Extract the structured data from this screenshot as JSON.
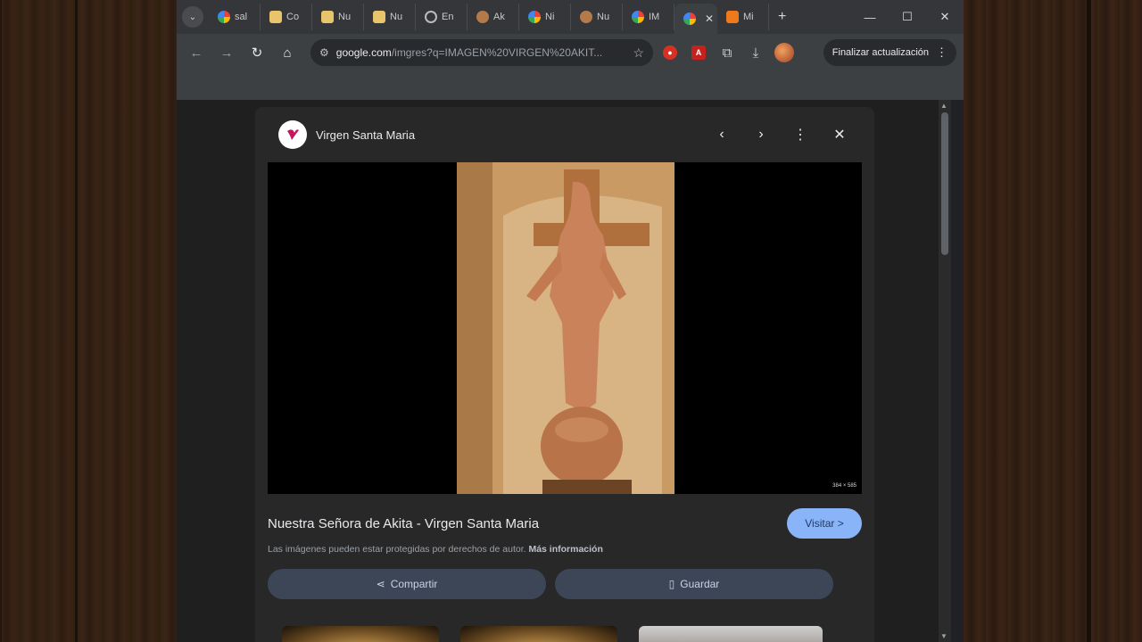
{
  "tabs": [
    {
      "label": "sal",
      "icon": "google-icon"
    },
    {
      "label": "Co",
      "icon": "document-icon"
    },
    {
      "label": "Nu",
      "icon": "document-icon"
    },
    {
      "label": "Nu",
      "icon": "document-icon"
    },
    {
      "label": "En",
      "icon": "globe-icon"
    },
    {
      "label": "Ak",
      "icon": "image-icon"
    },
    {
      "label": "Ni",
      "icon": "google-icon"
    },
    {
      "label": "Nu",
      "icon": "image-icon"
    },
    {
      "label": "IM",
      "icon": "google-icon"
    },
    {
      "label": "",
      "icon": "google-icon",
      "active": true
    },
    {
      "label": "Mi",
      "icon": "blogger-icon"
    }
  ],
  "toolbar": {
    "url_host": "google.com",
    "url_rest": "/imgres?q=IMAGEN%20VIRGEN%20AKIT...",
    "update_label": "Finalizar actualización"
  },
  "panel": {
    "site_name": "Virgen Santa Maria",
    "image_size": "384 × 585",
    "image_title": "Nuestra Señora de Akita - Virgen Santa Maria",
    "visit_label": "Visitar >",
    "copyright_text": "Las imágenes pueden estar protegidas por derechos de autor.",
    "more_info": "Más información",
    "share_label": "Compartir",
    "save_label": "Guardar"
  },
  "colors": {
    "accent": "#8ab4f8",
    "panel_bg": "#282828",
    "button_bg": "#3c4656"
  }
}
